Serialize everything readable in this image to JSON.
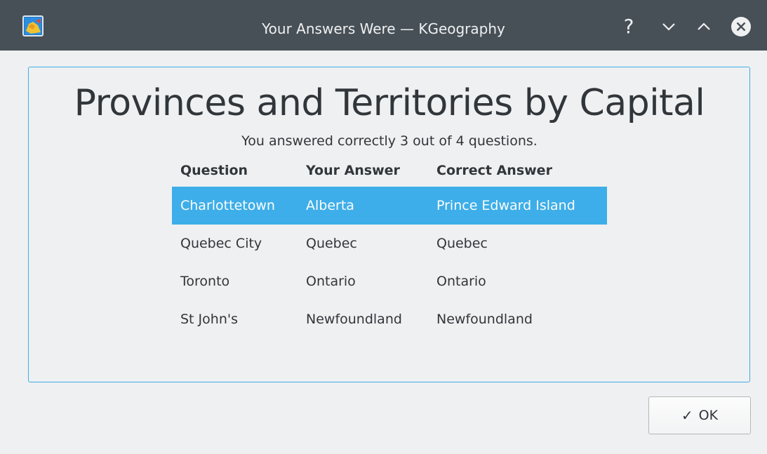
{
  "window": {
    "title": "Your Answers Were — KGeography",
    "help_glyph": "?"
  },
  "icons": {
    "app": "kgeography-app-icon",
    "help": "help-icon",
    "minimize": "minimize-chevron-down-icon",
    "maximize": "maximize-chevron-up-icon",
    "close": "close-circle-icon",
    "ok": "checkmark-icon"
  },
  "results": {
    "title": "Provinces and Territories by Capital",
    "summary": "You answered correctly 3 out of 4 questions.",
    "columns": [
      "Question",
      "Your Answer",
      "Correct Answer"
    ],
    "rows": [
      {
        "question": "Charlottetown",
        "your_answer": "Alberta",
        "correct_answer": "Prince Edward Island",
        "selected": true
      },
      {
        "question": "Quebec City",
        "your_answer": "Quebec",
        "correct_answer": "Quebec",
        "selected": false
      },
      {
        "question": "Toronto",
        "your_answer": "Ontario",
        "correct_answer": "Ontario",
        "selected": false
      },
      {
        "question": "St John's",
        "your_answer": "Newfoundland",
        "correct_answer": "Newfoundland",
        "selected": false
      }
    ]
  },
  "buttons": {
    "ok_label": "OK",
    "ok_glyph": "✓"
  },
  "colors": {
    "titlebar": "#475057",
    "accent": "#3daee9",
    "background": "#eff0f1",
    "text": "#31363b"
  }
}
